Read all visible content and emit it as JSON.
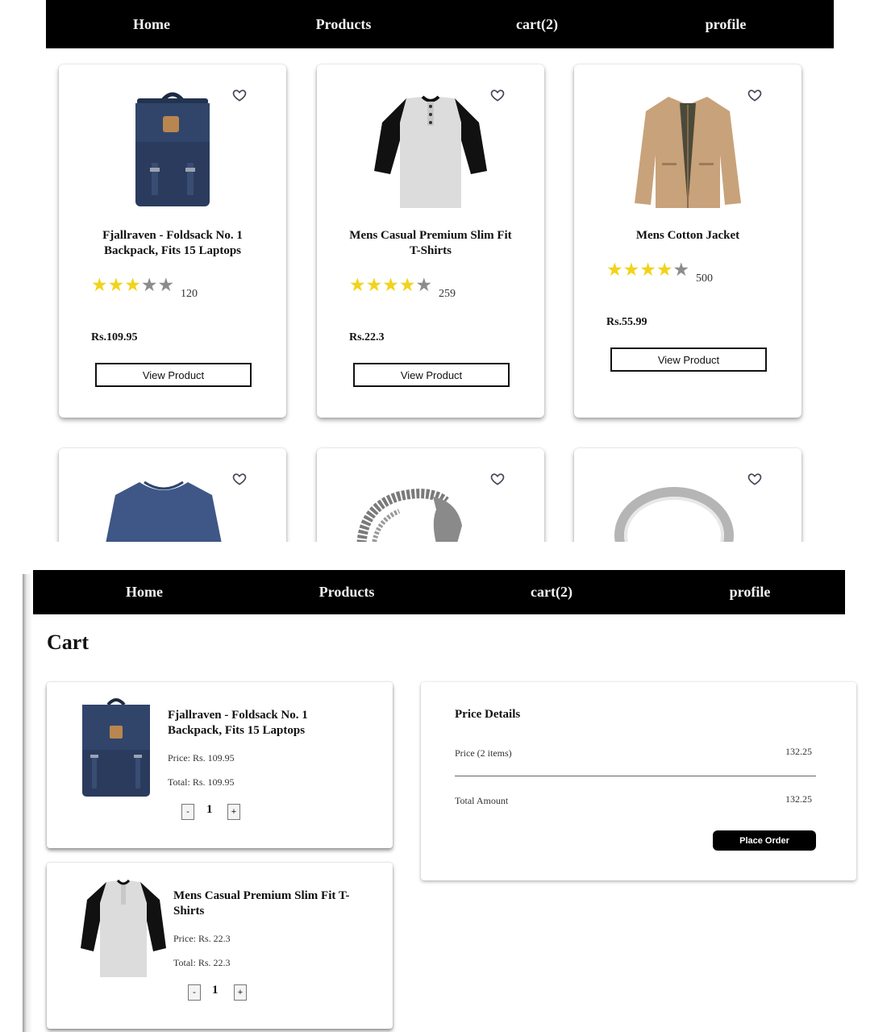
{
  "nav": {
    "home": "Home",
    "products": "Products",
    "cart": "cart(2)",
    "profile": "profile"
  },
  "products": [
    {
      "title": "Fjallraven - Foldsack No. 1 Backpack, Fits 15 Laptops",
      "rating_stars": 3,
      "rating_count": "120",
      "price": "Rs.109.95",
      "button": "View Product",
      "image_icon": "backpack-image"
    },
    {
      "title": "Mens Casual Premium Slim Fit T-Shirts",
      "rating_stars": 4,
      "rating_count": "259",
      "price": "Rs.22.3",
      "button": "View Product",
      "image_icon": "tshirt-image"
    },
    {
      "title": "Mens Cotton Jacket",
      "rating_stars": 4,
      "rating_count": "500",
      "price": "Rs.55.99",
      "button": "View Product",
      "image_icon": "jacket-image"
    }
  ],
  "products_row2_icons": [
    "sweater-image",
    "bracelet-image",
    "ring-image"
  ],
  "cart": {
    "title": "Cart",
    "items": [
      {
        "name": "Fjallraven - Foldsack No. 1 Backpack, Fits 15 Laptops",
        "price": "Price: Rs. 109.95",
        "total": "Total: Rs. 109.95",
        "qty": "1",
        "minus": "-",
        "plus": "+"
      },
      {
        "name": "Mens Casual Premium Slim Fit T-Shirts",
        "price": "Price: Rs. 22.3",
        "total": "Total: Rs. 22.3",
        "qty": "1",
        "minus": "-",
        "plus": "+"
      }
    ]
  },
  "price_details": {
    "title": "Price Details",
    "price_label": "Price (2 items)",
    "price_value": "132.25",
    "total_label": "Total Amount",
    "total_value": "132.25",
    "place_order": "Place Order"
  },
  "colors": {
    "nav_bg": "#000000",
    "star_on": "#f2d31c",
    "star_off": "#8c8c8c"
  }
}
